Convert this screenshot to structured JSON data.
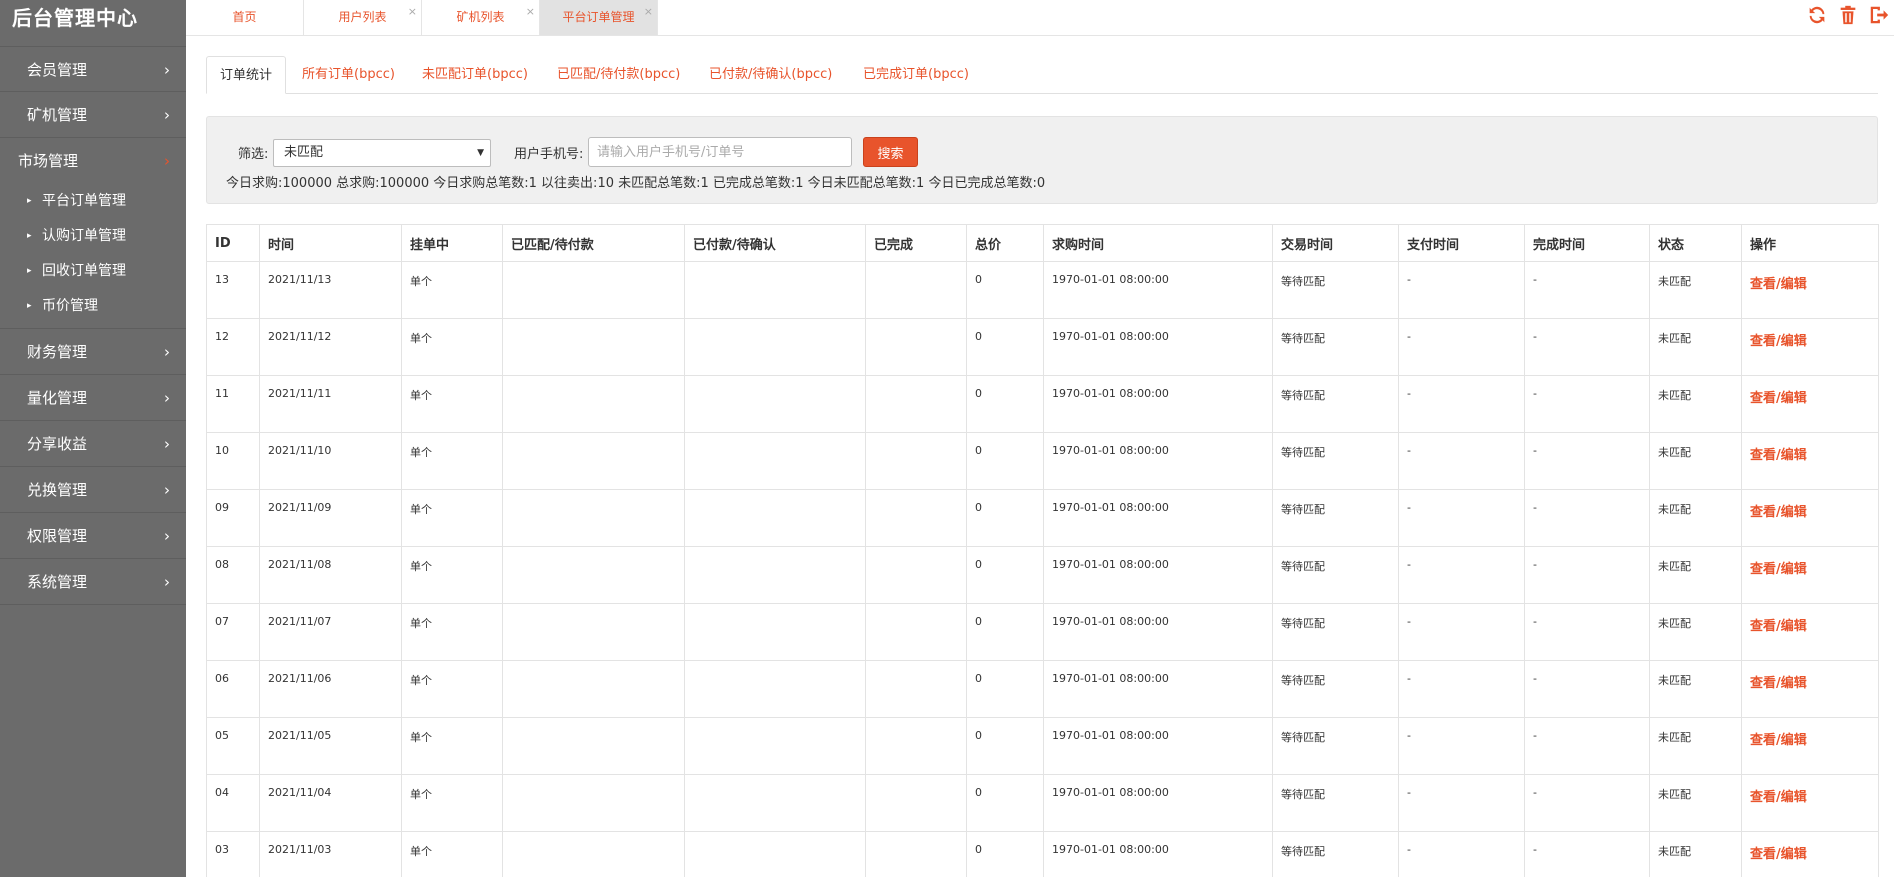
{
  "brand": "后台管理中心",
  "colors": {
    "accent": "#e8542c",
    "sidebar_bg": "#6b6b6b"
  },
  "sidebar": {
    "items": [
      {
        "label": "会员管理"
      },
      {
        "label": "矿机管理"
      },
      {
        "label": "市场管理",
        "expanded": true,
        "children": [
          {
            "label": "平台订单管理"
          },
          {
            "label": "认购订单管理"
          },
          {
            "label": "回收订单管理"
          },
          {
            "label": "币价管理"
          }
        ]
      },
      {
        "label": "财务管理"
      },
      {
        "label": "量化管理"
      },
      {
        "label": "分享收益"
      },
      {
        "label": "兑换管理"
      },
      {
        "label": "权限管理"
      },
      {
        "label": "系统管理"
      }
    ],
    "chevron": "›",
    "sub_marker": "▸"
  },
  "toptabs": [
    {
      "label": "首页"
    },
    {
      "label": "用户列表",
      "close": "×"
    },
    {
      "label": "矿机列表",
      "close": "×"
    },
    {
      "label": "平台订单管理",
      "close": "×",
      "active": true
    }
  ],
  "top_icons": [
    "refresh-icon",
    "trash-icon",
    "logout-icon"
  ],
  "subtabs": [
    {
      "label": "订单统计",
      "active": true
    },
    {
      "label": "所有订单(bpcc)"
    },
    {
      "label": "未匹配订单(bpcc)"
    },
    {
      "label": "已匹配/待付款(bpcc)"
    },
    {
      "label": "已付款/待确认(bpcc)"
    },
    {
      "label": "已完成订单(bpcc)"
    }
  ],
  "filter": {
    "select_label": "筛选:",
    "select_value": "未匹配",
    "phone_label": "用户手机号:",
    "phone_placeholder": "请输入用户手机号/订单号",
    "search_button": "搜索",
    "stats": "今日求购:100000 总求购:100000 今日求购总笔数:1 以往卖出:10 未匹配总笔数:1 已完成总笔数:1 今日未匹配总笔数:1 今日已完成总笔数:0"
  },
  "table": {
    "headers": [
      "ID",
      "时间",
      "挂单中",
      "已匹配/待付款",
      "已付款/待确认",
      "已完成",
      "总价",
      "求购时间",
      "交易时间",
      "支付时间",
      "完成时间",
      "状态",
      "操作"
    ],
    "rows": [
      [
        "13",
        "2021/11/13",
        "单个",
        "",
        "",
        "",
        "0",
        "1970-01-01 08:00:00",
        "等待匹配",
        "-",
        "-",
        "未匹配",
        "查看/编辑"
      ],
      [
        "12",
        "2021/11/12",
        "单个",
        "",
        "",
        "",
        "0",
        "1970-01-01 08:00:00",
        "等待匹配",
        "-",
        "-",
        "未匹配",
        "查看/编辑"
      ],
      [
        "11",
        "2021/11/11",
        "单个",
        "",
        "",
        "",
        "0",
        "1970-01-01 08:00:00",
        "等待匹配",
        "-",
        "-",
        "未匹配",
        "查看/编辑"
      ],
      [
        "10",
        "2021/11/10",
        "单个",
        "",
        "",
        "",
        "0",
        "1970-01-01 08:00:00",
        "等待匹配",
        "-",
        "-",
        "未匹配",
        "查看/编辑"
      ],
      [
        "09",
        "2021/11/09",
        "单个",
        "",
        "",
        "",
        "0",
        "1970-01-01 08:00:00",
        "等待匹配",
        "-",
        "-",
        "未匹配",
        "查看/编辑"
      ],
      [
        "08",
        "2021/11/08",
        "单个",
        "",
        "",
        "",
        "0",
        "1970-01-01 08:00:00",
        "等待匹配",
        "-",
        "-",
        "未匹配",
        "查看/编辑"
      ],
      [
        "07",
        "2021/11/07",
        "单个",
        "",
        "",
        "",
        "0",
        "1970-01-01 08:00:00",
        "等待匹配",
        "-",
        "-",
        "未匹配",
        "查看/编辑"
      ],
      [
        "06",
        "2021/11/06",
        "单个",
        "",
        "",
        "",
        "0",
        "1970-01-01 08:00:00",
        "等待匹配",
        "-",
        "-",
        "未匹配",
        "查看/编辑"
      ],
      [
        "05",
        "2021/11/05",
        "单个",
        "",
        "",
        "",
        "0",
        "1970-01-01 08:00:00",
        "等待匹配",
        "-",
        "-",
        "未匹配",
        "查看/编辑"
      ],
      [
        "04",
        "2021/11/04",
        "单个",
        "",
        "",
        "",
        "0",
        "1970-01-01 08:00:00",
        "等待匹配",
        "-",
        "-",
        "未匹配",
        "查看/编辑"
      ],
      [
        "03",
        "2021/11/03",
        "单个",
        "",
        "",
        "",
        "0",
        "1970-01-01 08:00:00",
        "等待匹配",
        "-",
        "-",
        "未匹配",
        "查看/编辑"
      ]
    ]
  }
}
